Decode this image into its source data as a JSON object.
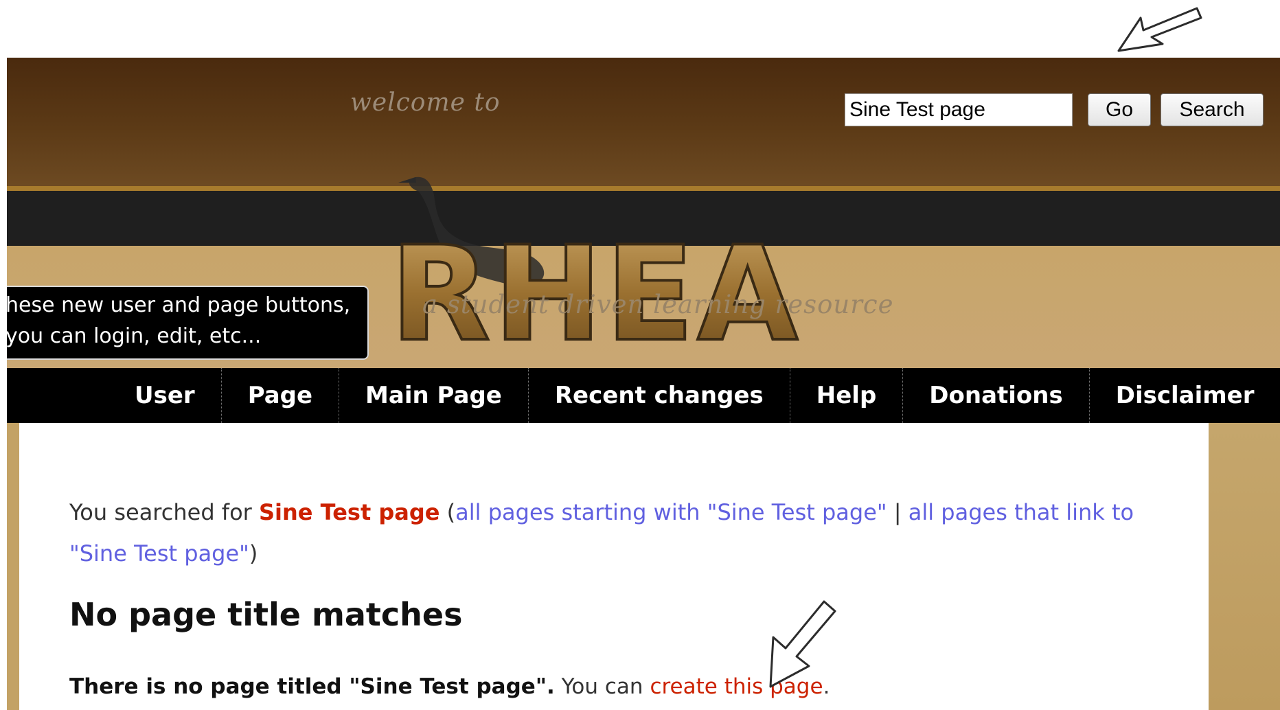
{
  "header": {
    "welcome_text": "welcome to",
    "logo_text": "RHEA",
    "tagline": "a student driven learning resource",
    "search": {
      "value": "Sine Test page",
      "go_label": "Go",
      "search_label": "Search"
    },
    "tooltip": {
      "line1": "hese new user and page buttons,",
      "line2": "you can login, edit, etc..."
    }
  },
  "nav": {
    "items": [
      {
        "label": "User"
      },
      {
        "label": "Page"
      },
      {
        "label": "Main Page"
      },
      {
        "label": "Recent changes"
      },
      {
        "label": "Help"
      },
      {
        "label": "Donations"
      },
      {
        "label": "Disclaimer"
      }
    ]
  },
  "content": {
    "searched_prefix": "You searched for",
    "search_term": "Sine Test page",
    "open_paren": " (",
    "link_starting": "all pages starting with \"Sine Test page\"",
    "separator": " | ",
    "link_linking": "all pages that link to \"Sine Test page\"",
    "close_paren": ")",
    "heading": "No page title matches",
    "no_page_bold": "There is no page titled \"Sine Test page\".",
    "you_can": " You can",
    "create_link": "create this page",
    "period": "."
  },
  "colors": {
    "header_brown": "#4a2c10",
    "tan": "#c8a56a",
    "nav_bg": "#000000",
    "highlight_red": "#cc2200",
    "link_blue": "#6060e0"
  }
}
